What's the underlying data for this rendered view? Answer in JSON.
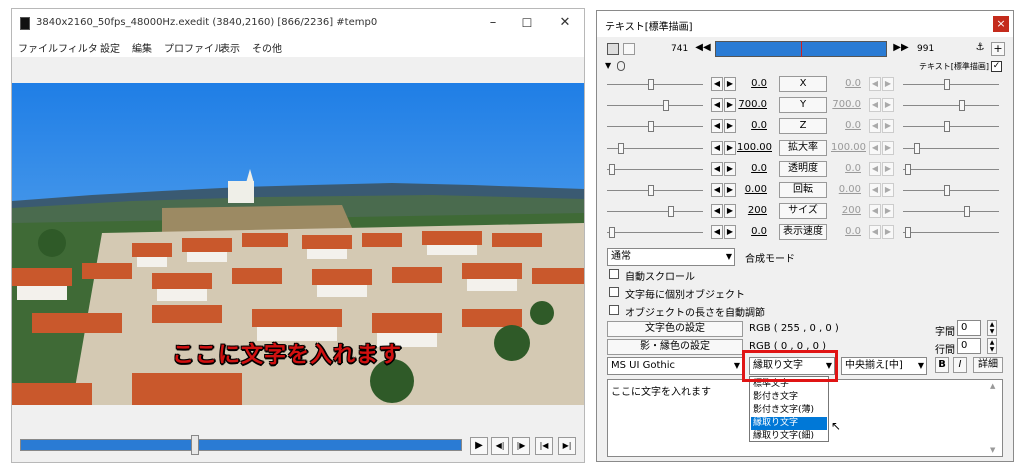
{
  "preview": {
    "title": "3840x2160_50fps_48000Hz.exedit (3840,2160)  [866/2236]  #temp0",
    "menu": [
      "ファイル",
      "フィルタ",
      "設定",
      "編集",
      "プロファイル",
      "表示",
      "その他"
    ],
    "caption": "ここに文字を入れます",
    "seek_progress": 0.387,
    "controls": [
      "▶",
      "◀|",
      "|▶",
      "|◀",
      "▶|"
    ]
  },
  "props": {
    "title": "テキスト[標準描画]",
    "close": "×",
    "frame_start": "741",
    "frame_end": "991",
    "layer_label": "テキスト[標準描画]",
    "params": [
      {
        "label": "X",
        "start": "0.0",
        "end": "0.0",
        "s1": 0.45,
        "s2": 0.45
      },
      {
        "label": "Y",
        "start": "700.0",
        "end": "700.0",
        "s1": 0.62,
        "s2": 0.62
      },
      {
        "label": "Z",
        "start": "0.0",
        "end": "0.0",
        "s1": 0.45,
        "s2": 0.45
      },
      {
        "label": "拡大率",
        "start": "100.00",
        "end": "100.00",
        "s1": 0.12,
        "s2": 0.12
      },
      {
        "label": "透明度",
        "start": "0.0",
        "end": "0.0",
        "s1": 0.02,
        "s2": 0.02
      },
      {
        "label": "回転",
        "start": "0.00",
        "end": "0.00",
        "s1": 0.45,
        "s2": 0.45
      },
      {
        "label": "サイズ",
        "start": "200",
        "end": "200",
        "s1": 0.68,
        "s2": 0.68
      },
      {
        "label": "表示速度",
        "start": "0.0",
        "end": "0.0",
        "s1": 0.02,
        "s2": 0.02
      }
    ],
    "blend_mode": "通常",
    "blend_label": "合成モード",
    "checkboxes": [
      "自動スクロール",
      "文字毎に個別オブジェクト",
      "オブジェクトの長さを自動調節"
    ],
    "text_color_button": "文字色の設定",
    "text_color_value": "RGB ( 255 , 0 , 0 )",
    "shadow_color_button": "影・縁色の設定",
    "shadow_color_value": "RGB ( 0 , 0 , 0 )",
    "spacing_label": "字間",
    "spacing_value": "0",
    "line_label": "行間",
    "line_value": "0",
    "font": "MS UI Gothic",
    "decoration": "縁取り文字",
    "align": "中央揃え[中]",
    "bold": "B",
    "italic": "I",
    "detail": "詳細",
    "text": "ここに文字を入れます",
    "options": [
      "標準文字",
      "影付き文字",
      "影付き文字(薄)",
      "縁取り文字",
      "縁取り文字(細)"
    ],
    "selected_option_index": 3
  }
}
